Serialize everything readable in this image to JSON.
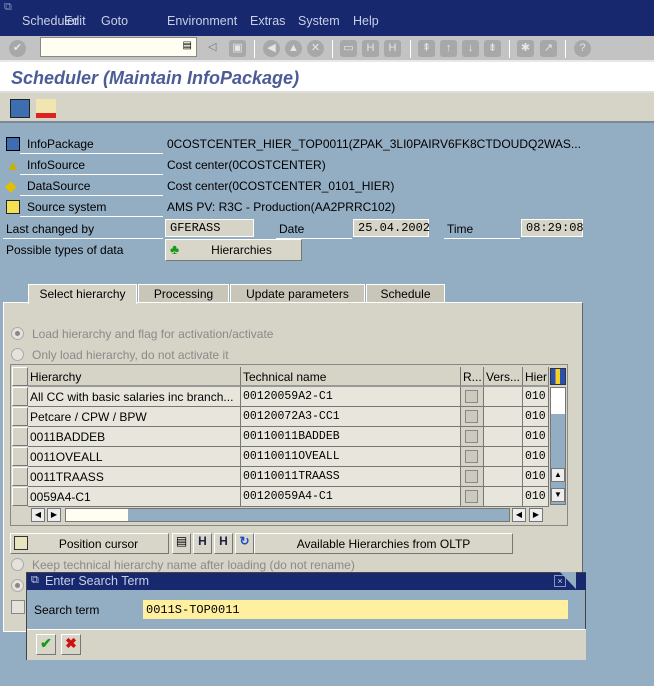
{
  "menu": [
    "Scheduler",
    "Edit",
    "Goto",
    "Environment",
    "Extras",
    "System",
    "Help"
  ],
  "toolbar": {
    "command_value": "",
    "icons": [
      "enter-icon",
      "back-icon",
      "save-icon",
      "back-arrow-icon",
      "exit-icon",
      "cancel-icon",
      "print-icon",
      "find-icon",
      "find-next-icon",
      "first-page-icon",
      "prev-page-icon",
      "next-page-icon",
      "last-page-icon",
      "create-session-icon",
      "shortcut-icon",
      "help-icon"
    ]
  },
  "title": "Scheduler (Maintain InfoPackage)",
  "app_toolbar": [
    "monitor-icon",
    "transport-icon"
  ],
  "header": {
    "infopackage_label": "InfoPackage",
    "infopackage_value": "0COSTCENTER_HIER_TOP0011(ZPAK_3LI0PAIRV6FK8CTDOUDQ2WAS...",
    "infosource_label": "InfoSource",
    "infosource_value": "Cost center(0COSTCENTER)",
    "datasource_label": "DataSource",
    "datasource_value": "Cost center(0COSTCENTER_0101_HIER)",
    "sourcesys_label": "Source system",
    "sourcesys_value": "AMS PV: R3C - Production(AA2PRRC102)",
    "changed_label": "Last changed by",
    "changed_value": "GFERASS",
    "date_label": "Date",
    "date_value": "25.04.2002",
    "time_label": "Time",
    "time_value": "08:29:08",
    "types_label": "Possible types of data",
    "types_button": "Hierarchies"
  },
  "tabs": [
    {
      "label": "Select hierarchy",
      "active": true
    },
    {
      "label": "Processing"
    },
    {
      "label": "Update parameters"
    },
    {
      "label": "Schedule"
    }
  ],
  "radios": {
    "opt1": "Load hierarchy and flag for activation/activate",
    "opt1_selected": true,
    "opt2": "Only load hierarchy, do not activate it",
    "keep": "Keep technical hierarchy name after loading (do not rename)"
  },
  "table": {
    "columns": [
      "Hierarchy",
      "Technical name",
      "R...",
      "Vers...",
      "Hier"
    ],
    "rows": [
      [
        "All CC with basic salaries inc branch...",
        "00120059A2-C1",
        "",
        "",
        "010"
      ],
      [
        "Petcare / CPW / BPW",
        "00120072A3-CC1",
        "",
        "",
        "010"
      ],
      [
        "0011BADDEB",
        "00110011BADDEB",
        "",
        "",
        "010"
      ],
      [
        "0011OVEALL",
        "00110011OVEALL",
        "",
        "",
        "010"
      ],
      [
        "0011TRAASS",
        "00110011TRAASS",
        "",
        "",
        "010"
      ],
      [
        "0059A4-C1",
        "00120059A4-C1",
        "",
        "",
        "010"
      ]
    ]
  },
  "buttons": {
    "position_cursor": "Position cursor",
    "available": "Available Hierarchies from OLTP"
  },
  "dialog": {
    "title": "Enter Search Term",
    "label": "Search term",
    "value": "0011S-TOP0011"
  },
  "colors": {
    "titlebar": "#17286e",
    "background": "#93adc2",
    "panel": "#d6d3c7",
    "title_text": "#4c5c96",
    "input_highlight": "#fff0a0"
  }
}
